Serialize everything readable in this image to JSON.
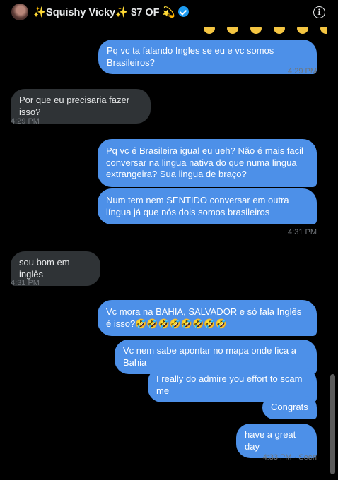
{
  "header": {
    "title": "✨Squishy Vicky✨ $7 OF 💫",
    "avatar": "profile-photo",
    "info_icon": "i"
  },
  "messages": [
    {
      "dir": "out",
      "text": "Pq vc ta falando Ingles se eu e vc somos Brasileiros?",
      "time": "4:29 PM"
    },
    {
      "dir": "in",
      "text": "Por que eu precisaria fazer isso?",
      "time": "4:29 PM"
    },
    {
      "dir": "out",
      "text": "Pq vc é Brasileira igual eu ueh? Não é mais facil conversar na lingua nativa do que numa lingua extrangeira? Sua lingua de braço?"
    },
    {
      "dir": "out",
      "text": "Num tem nem SENTIDO conversar em outra língua já que nós dois somos brasileiros",
      "time": "4:31 PM"
    },
    {
      "dir": "in",
      "text": "sou bom em inglês",
      "time": "4:31 PM"
    },
    {
      "dir": "out",
      "text": "Vc mora na BAHIA, SALVADOR e só fala Inglês é isso?🤣🤣🤣🤣🤣🤣🤣🤣"
    },
    {
      "dir": "out",
      "text": "Vc nem sabe apontar no mapa onde fica a Bahia"
    },
    {
      "dir": "out",
      "text": "I really do admire you effort to scam me"
    },
    {
      "dir": "out",
      "text": "Congrats"
    },
    {
      "dir": "out",
      "text": "have a great day",
      "time": "4:33 PM · Seen"
    }
  ],
  "colors": {
    "outgoing": "#4d90e8",
    "incoming": "#2f3336",
    "background": "#000000"
  }
}
